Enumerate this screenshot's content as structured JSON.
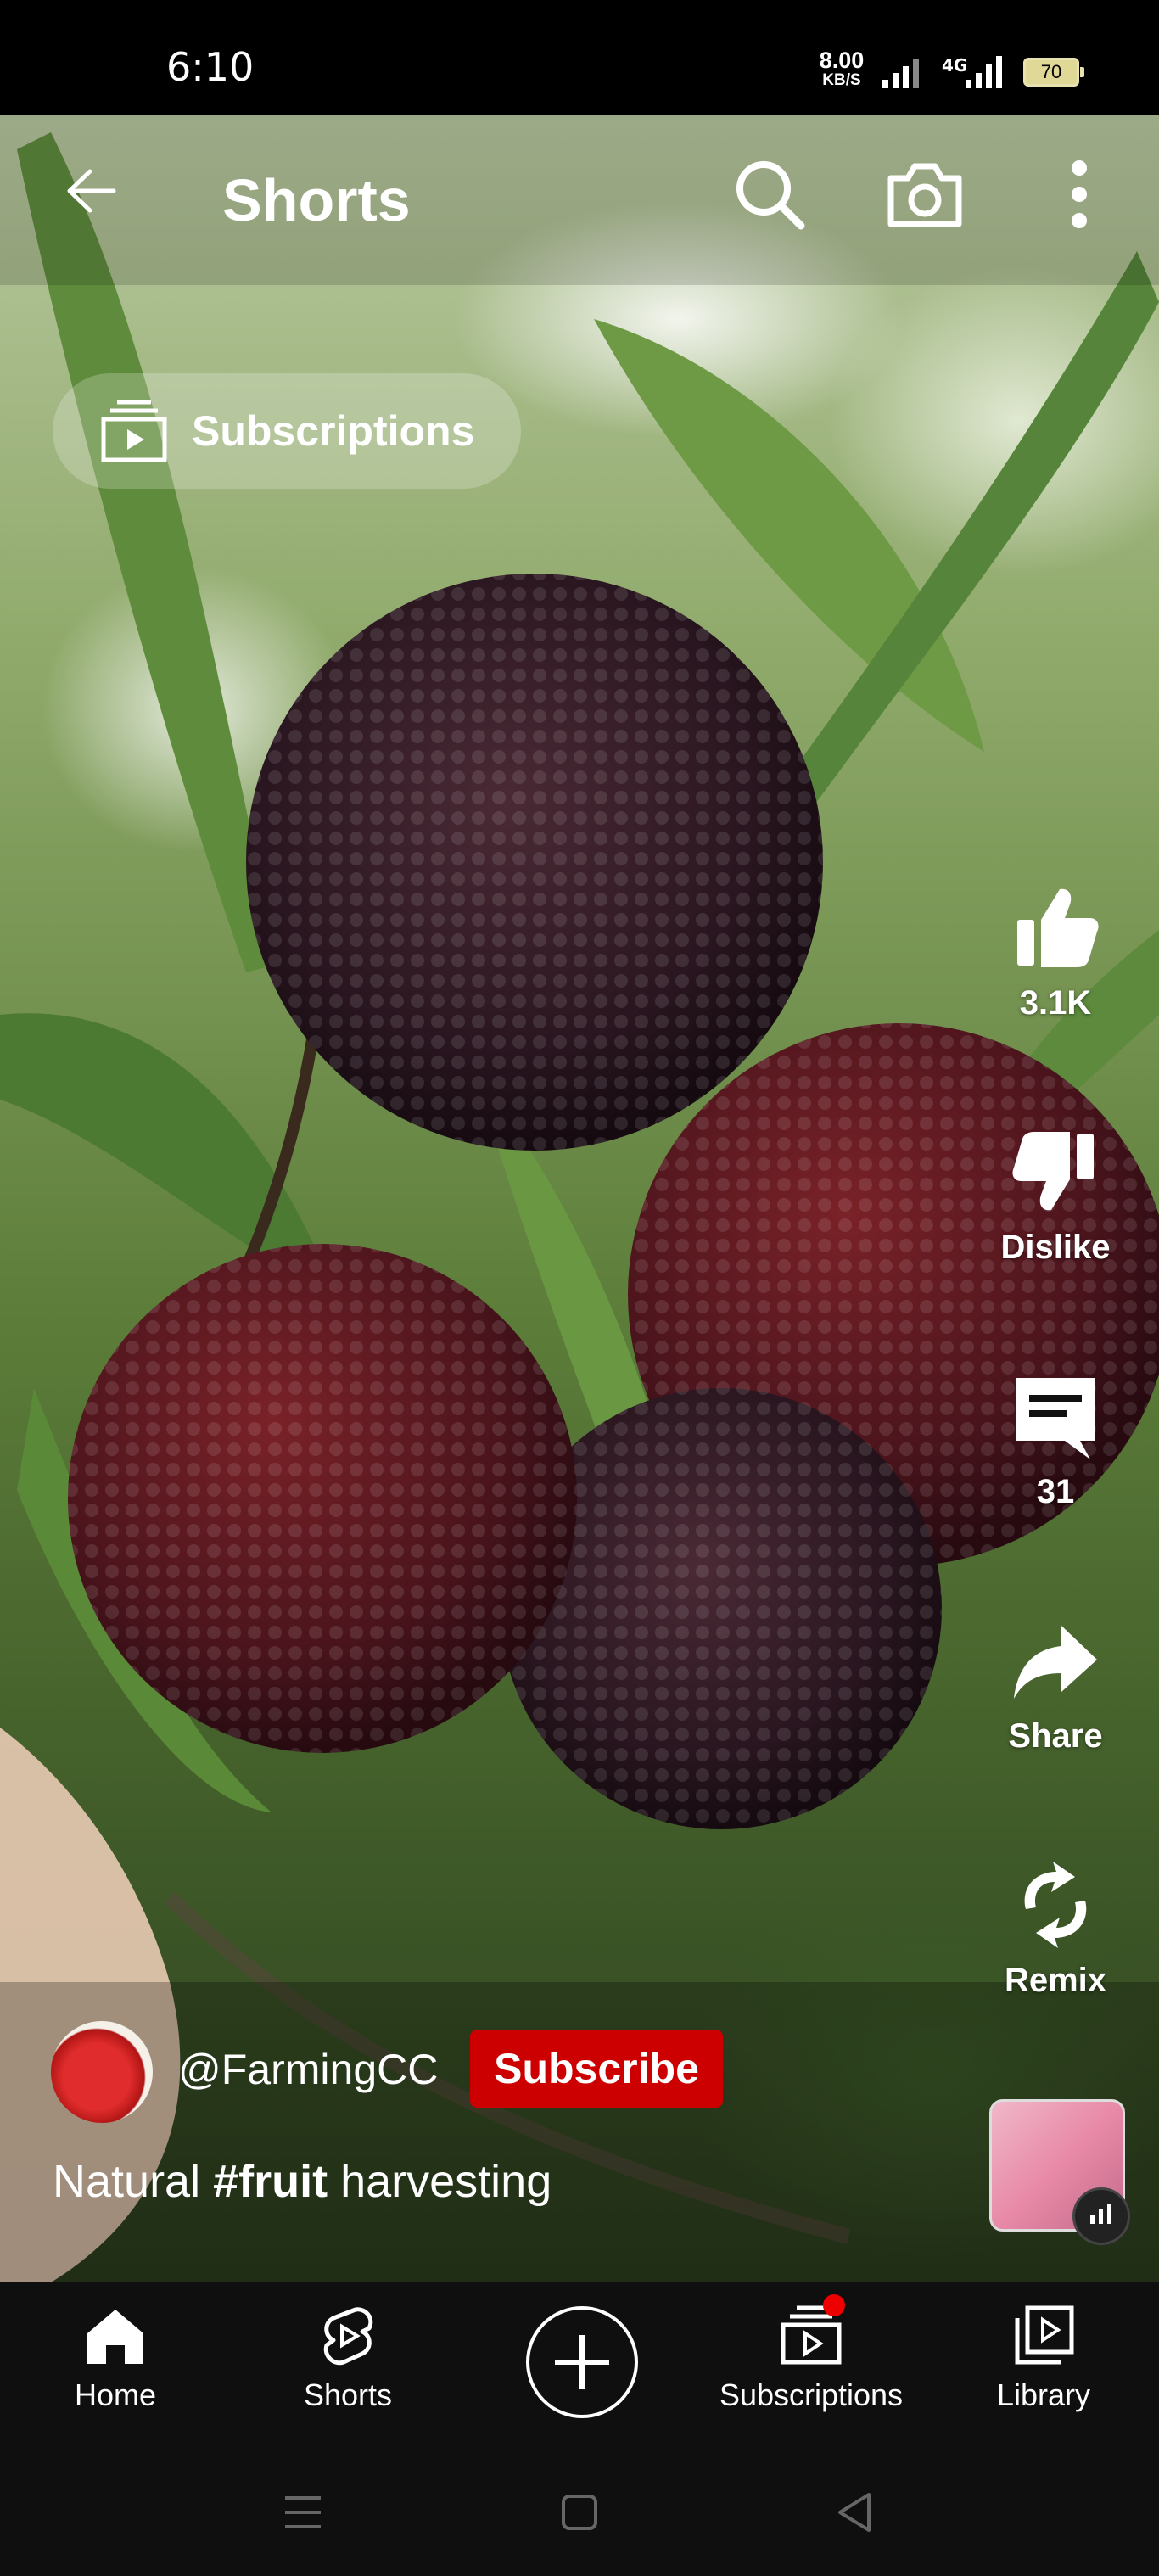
{
  "status_bar": {
    "time": "6:10",
    "net_speed_value": "8.00",
    "net_speed_unit": "KB/S",
    "network_type": "4G",
    "battery": "70"
  },
  "header": {
    "title": "Shorts",
    "back_icon": "arrow-left-icon",
    "search_icon": "search-icon",
    "camera_icon": "camera-icon",
    "more_icon": "more-vertical-icon"
  },
  "subscriptions_chip": {
    "label": "Subscriptions",
    "icon": "subscriptions-icon"
  },
  "actions": {
    "like": {
      "label": "3.1K",
      "icon": "thumbs-up-icon"
    },
    "dislike": {
      "label": "Dislike",
      "icon": "thumbs-down-icon"
    },
    "comments": {
      "label": "31",
      "icon": "comment-icon"
    },
    "share": {
      "label": "Share",
      "icon": "share-icon"
    },
    "remix": {
      "label": "Remix",
      "icon": "remix-icon"
    }
  },
  "video": {
    "channel_handle": "@FarmingCC",
    "subscribe_label": "Subscribe",
    "caption_before": "Natural ",
    "caption_hashtag": "#fruit",
    "caption_after": " harvesting"
  },
  "bottom_nav": {
    "items": [
      {
        "label": "Home",
        "icon": "home-icon"
      },
      {
        "label": "Shorts",
        "icon": "shorts-icon"
      },
      {
        "label": "",
        "icon": "create-plus-icon"
      },
      {
        "label": "Subscriptions",
        "icon": "subscriptions-icon"
      },
      {
        "label": "Library",
        "icon": "library-icon"
      }
    ]
  },
  "colors": {
    "subscribe_red": "#cc0000",
    "nav_background": "#0f0f0f",
    "notification_dot": "#ee0000"
  }
}
